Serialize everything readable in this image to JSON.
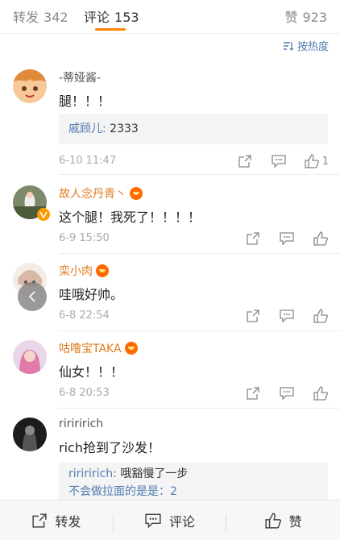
{
  "tabs": [
    {
      "label": "转发",
      "count": "342"
    },
    {
      "label": "评论",
      "count": "153"
    },
    {
      "label": "赞",
      "count": "923"
    }
  ],
  "sort_label": "按热度",
  "comments": [
    {
      "name": "-蒂娅酱-",
      "text": "腿！！！",
      "reply_who": "戚顾儿:",
      "reply_text": " 2333",
      "time": "6-10 11:47",
      "likes": "1"
    },
    {
      "name": "故人念丹青丶",
      "text": "这个腿！我死了！！！！",
      "time": "6-9 15:50"
    },
    {
      "name": "栾小肉",
      "text": "哇哦好帅。",
      "time": "6-8 22:54"
    },
    {
      "name": "咕噜宝TAKA",
      "text": "仙女！！！",
      "time": "6-8 20:53"
    },
    {
      "name": "ririririch",
      "text": "rich抢到了沙发！",
      "reply_who": "ririririch:",
      "reply_text": " 哦豁慢了一步",
      "reply2": "不会做拉面的是是：2"
    }
  ],
  "bottom": {
    "repost": "转发",
    "comment": "评论",
    "like": "赞"
  }
}
